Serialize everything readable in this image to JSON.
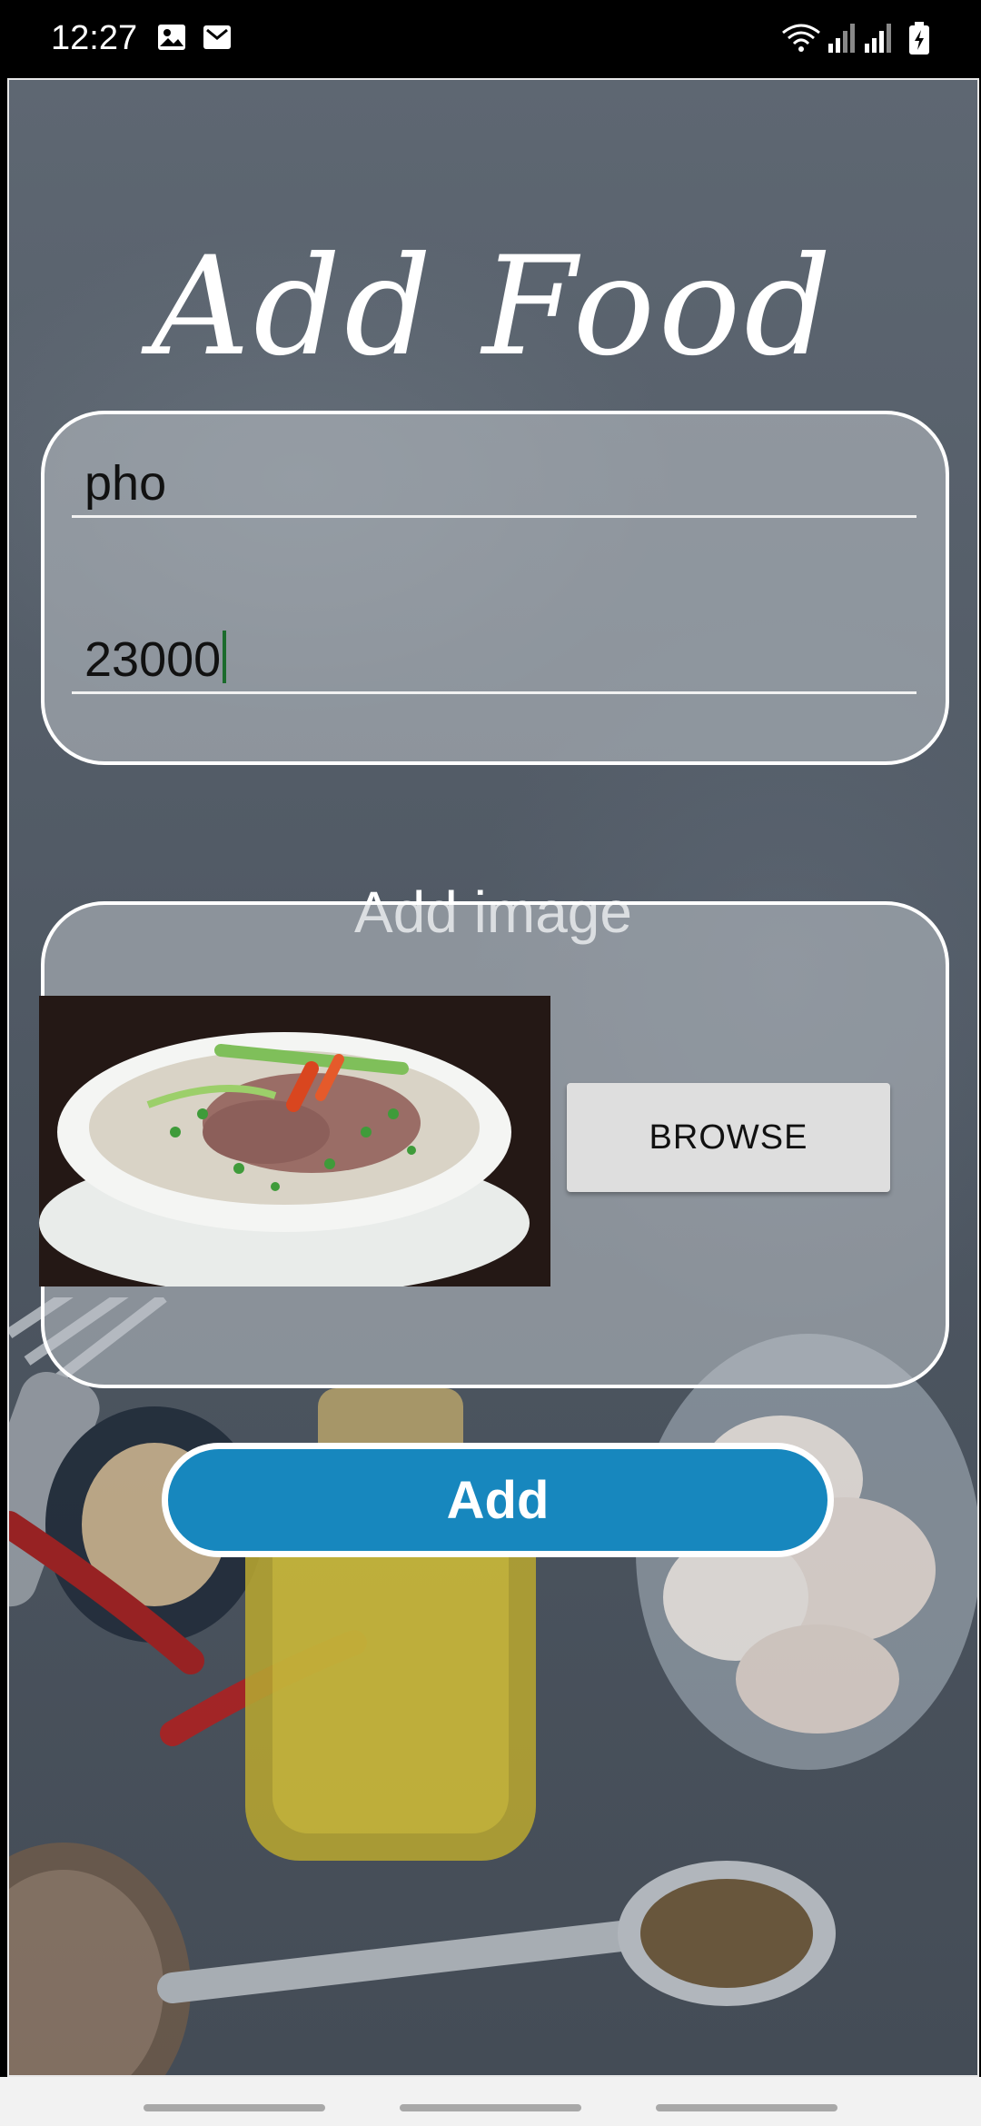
{
  "status_bar": {
    "time": "12:27",
    "left_icons": [
      "image-icon",
      "mail-icon"
    ],
    "right_icons": [
      "wifi-icon",
      "signal-icon",
      "signal-icon",
      "battery-charging-icon"
    ]
  },
  "screen": {
    "title": "Add Food",
    "fields": {
      "name_value": "pho",
      "price_value": "23000"
    },
    "add_image_label": "Add image",
    "browse_label": "BROWSE",
    "submit_label": "Add"
  },
  "colors": {
    "accent": "#1787be",
    "card_border": "#ffffff",
    "background": "#525b66"
  }
}
